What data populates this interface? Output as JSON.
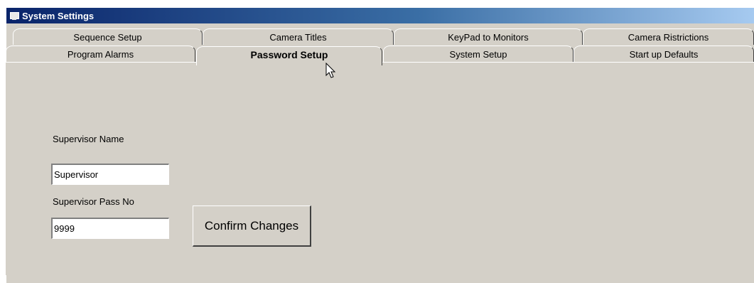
{
  "window": {
    "title": "System Settings"
  },
  "tabs": {
    "back_row": [
      {
        "label": "Sequence Setup"
      },
      {
        "label": "Camera Titles"
      },
      {
        "label": "KeyPad to Monitors"
      },
      {
        "label": "Camera Ristrictions"
      }
    ],
    "front_row": [
      {
        "label": "Program Alarms"
      },
      {
        "label": "Password Setup",
        "active": true
      },
      {
        "label": "System Setup"
      },
      {
        "label": "Start up Defaults"
      }
    ]
  },
  "form": {
    "supervisor_name_label": "Supervisor Name",
    "supervisor_name_value": "Supervisor",
    "supervisor_pass_label": "Supervisor Pass No",
    "supervisor_pass_value": "9999",
    "confirm_button_label": "Confirm Changes"
  }
}
